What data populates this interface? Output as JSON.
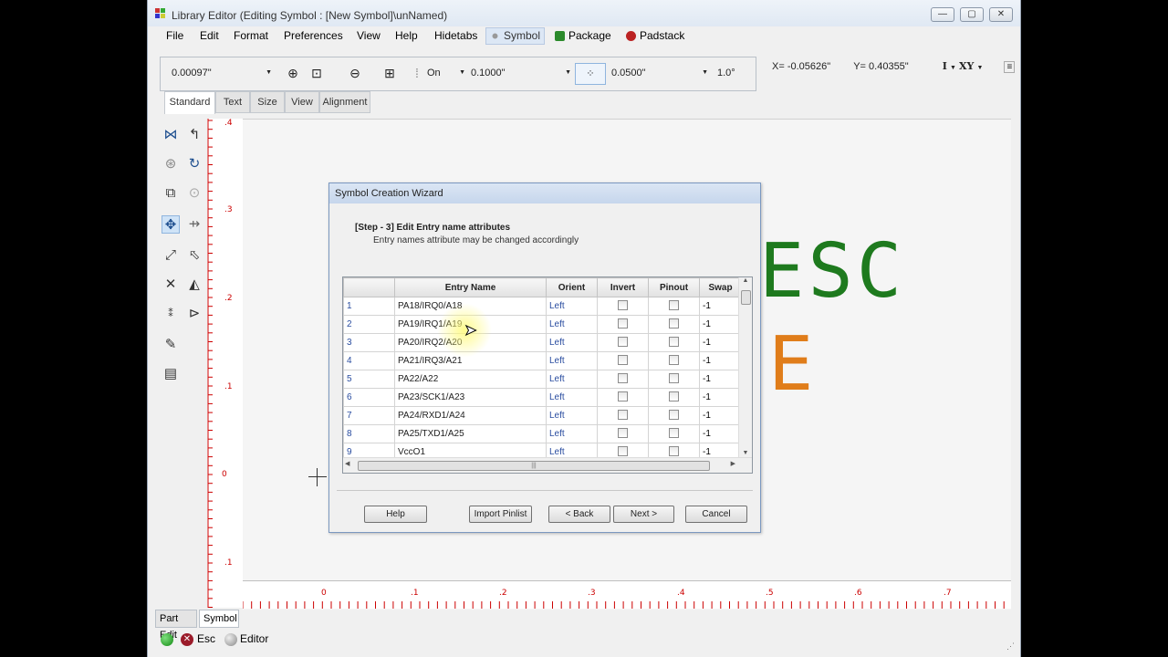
{
  "window": {
    "title": "Library Editor (Editing Symbol : [New Symbol]\\unNamed)"
  },
  "menu": {
    "items": [
      "File",
      "Edit",
      "Format",
      "Preferences",
      "View",
      "Help",
      "Hidetabs"
    ],
    "symbol": "Symbol",
    "package": "Package",
    "padstack": "Padstack"
  },
  "toolbar": {
    "grid_value": "0.00097\"",
    "snap_state": "On",
    "snap_value": "0.1000\"",
    "grid_size": "0.0500\"",
    "angle": "1.0°"
  },
  "coords": {
    "x": "X= -0.05626\"",
    "y": "Y= 0.40355\"",
    "mode1": "I",
    "mode2": "XY"
  },
  "tabs": [
    "Standard",
    "Text",
    "Size",
    "View",
    "Alignment"
  ],
  "vruler_labels": [
    ".4",
    ".3",
    ".2",
    ".1",
    "0",
    ".1"
  ],
  "hruler_labels": [
    "0",
    ".1",
    ".2",
    ".3",
    ".4",
    ".5",
    ".6",
    ".7"
  ],
  "canvas_text": {
    "line1": "ESC",
    "line2": "E"
  },
  "bottom_tabs": [
    "Part Edit",
    "Symbol"
  ],
  "status": {
    "esc": "Esc",
    "editor": "Editor"
  },
  "dialog": {
    "title": "Symbol Creation Wizard",
    "step_title": "[Step - 3] Edit Entry name attributes",
    "step_sub": "Entry names attribute may be changed accordingly",
    "columns": [
      "Entry Name",
      "Orient",
      "Invert",
      "Pinout",
      "Swap"
    ],
    "rows": [
      {
        "num": "1",
        "name": "PA18/IRQ0/A18",
        "orient": "Left",
        "swap": "-1"
      },
      {
        "num": "2",
        "name": "PA19/IRQ1/A19",
        "orient": "Left",
        "swap": "-1"
      },
      {
        "num": "3",
        "name": "PA20/IRQ2/A20",
        "orient": "Left",
        "swap": "-1"
      },
      {
        "num": "4",
        "name": "PA21/IRQ3/A21",
        "orient": "Left",
        "swap": "-1"
      },
      {
        "num": "5",
        "name": "PA22/A22",
        "orient": "Left",
        "swap": "-1"
      },
      {
        "num": "6",
        "name": "PA23/SCK1/A23",
        "orient": "Left",
        "swap": "-1"
      },
      {
        "num": "7",
        "name": "PA24/RXD1/A24",
        "orient": "Left",
        "swap": "-1"
      },
      {
        "num": "8",
        "name": "PA25/TXD1/A25",
        "orient": "Left",
        "swap": "-1"
      },
      {
        "num": "9",
        "name": "VccO1",
        "orient": "Left",
        "swap": "-1"
      }
    ],
    "buttons": {
      "help": "Help",
      "import": "Import Pinlist",
      "back": "< Back",
      "next": "Next >",
      "cancel": "Cancel"
    }
  }
}
